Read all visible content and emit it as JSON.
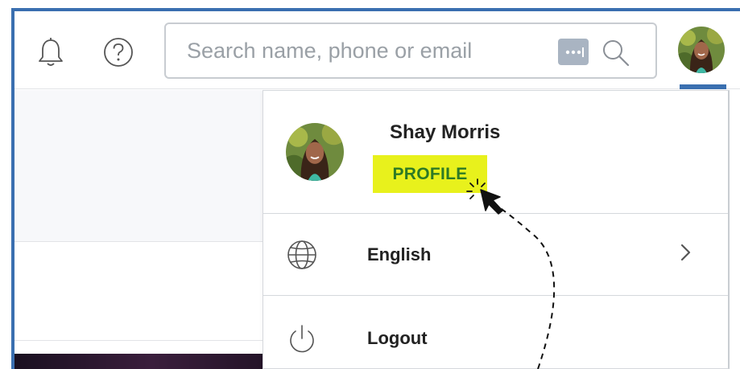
{
  "header": {
    "search": {
      "placeholder": "Search name, phone or email"
    },
    "icons": [
      "bell-icon",
      "help-icon",
      "more-dots-icon",
      "search-icon"
    ]
  },
  "menu": {
    "user_name": "Shay Morris",
    "profile_label": "PROFILE",
    "items": [
      {
        "label": "English",
        "icon": "globe-icon",
        "has_submenu": true
      },
      {
        "label": "Logout",
        "icon": "power-icon",
        "has_submenu": false
      }
    ]
  },
  "colors": {
    "accent": "#3a6fb0",
    "profile_highlight": "#e8f11c",
    "profile_text": "#2d7a25"
  }
}
